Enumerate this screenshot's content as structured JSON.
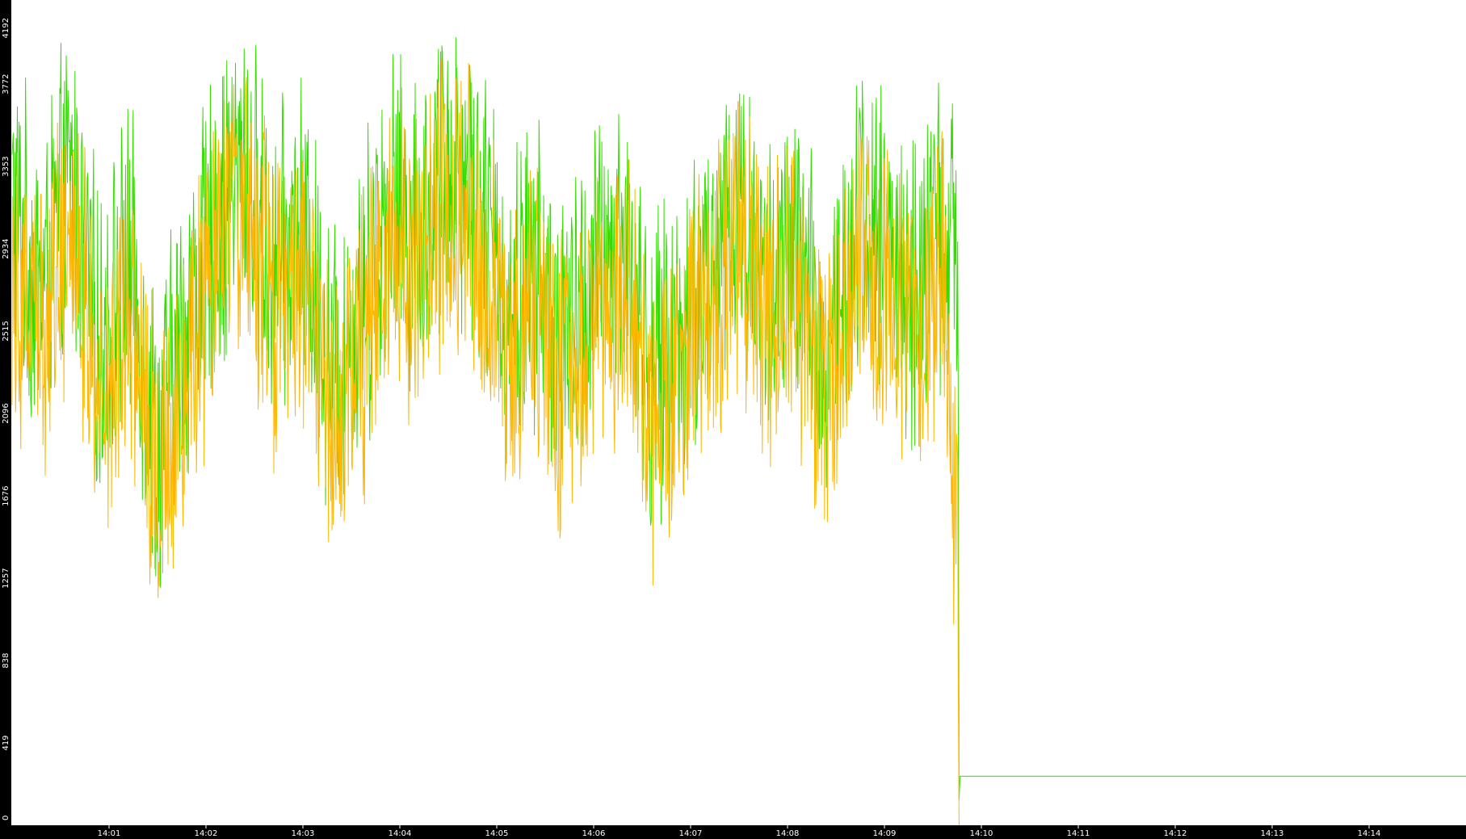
{
  "chart_data": {
    "type": "line",
    "title": "",
    "xlabel": "",
    "ylabel": "",
    "ylim": [
      0,
      4192
    ],
    "xlim_minutes": [
      14.0,
      15.0
    ],
    "y_ticks": [
      "0",
      "419",
      "838",
      "1257",
      "1676",
      "2096",
      "2515",
      "2934",
      "3353",
      "3772",
      "4192"
    ],
    "x_ticks": [
      {
        "label": "14:01",
        "t": 14.0167
      },
      {
        "label": "14:02",
        "t": 14.0333
      },
      {
        "label": "14:03",
        "t": 14.05
      },
      {
        "label": "14:04",
        "t": 14.0667
      },
      {
        "label": "14:05",
        "t": 14.0833
      },
      {
        "label": "14:06",
        "t": 14.1
      },
      {
        "label": "14:07",
        "t": 14.1167
      },
      {
        "label": "14:08",
        "t": 14.1333
      },
      {
        "label": "14:09",
        "t": 14.15
      },
      {
        "label": "14:10",
        "t": 14.1667
      },
      {
        "label": "14:11",
        "t": 14.1833
      },
      {
        "label": "14:12",
        "t": 14.2
      },
      {
        "label": "14:13",
        "t": 14.2167
      },
      {
        "label": "14:14",
        "t": 14.2333
      }
    ],
    "grid": false,
    "colors": {
      "axis_band": "#000000",
      "background": "#ffffff",
      "series_green": "#33dd00",
      "series_orange": "#ffb800"
    },
    "series": [
      {
        "color": "#33dd00",
        "x_minutes": [
          0.0,
          0.3,
          0.6,
          0.9,
          1.2,
          1.5,
          1.8,
          2.1,
          2.4,
          2.7,
          3.0,
          3.3,
          3.6,
          3.9,
          4.2,
          4.5,
          4.8,
          5.1,
          5.4,
          5.7,
          6.0,
          6.3,
          6.6,
          6.9,
          7.2,
          7.5,
          7.8,
          8.1,
          8.4,
          8.7,
          9.0,
          9.3,
          9.6,
          9.76,
          9.77,
          9.78,
          15.0
        ],
        "values": [
          3150,
          2700,
          3300,
          2400,
          2900,
          1900,
          2600,
          3050,
          3350,
          2800,
          3000,
          2300,
          2650,
          3200,
          3000,
          3400,
          3250,
          2600,
          2850,
          2400,
          2750,
          3000,
          2250,
          2500,
          2800,
          3200,
          2700,
          2900,
          2300,
          3150,
          2950,
          2700,
          3050,
          2800,
          130,
          250,
          250
        ]
      },
      {
        "color": "#ffb800",
        "x_minutes": [
          0.0,
          0.3,
          0.6,
          0.9,
          1.2,
          1.5,
          1.8,
          2.1,
          2.4,
          2.7,
          3.0,
          3.3,
          3.6,
          3.9,
          4.2,
          4.5,
          4.8,
          5.1,
          5.4,
          5.7,
          6.0,
          6.3,
          6.6,
          6.9,
          7.2,
          7.5,
          7.8,
          8.1,
          8.4,
          8.7,
          9.0,
          9.3,
          9.6,
          9.76,
          9.77
        ],
        "values": [
          2900,
          2500,
          3100,
          2100,
          2750,
          1700,
          2400,
          2850,
          3150,
          2600,
          2800,
          2100,
          2450,
          3000,
          2800,
          3200,
          3050,
          2400,
          2650,
          2200,
          2500,
          2800,
          2050,
          2300,
          2600,
          3000,
          2500,
          2700,
          2100,
          2950,
          2750,
          2500,
          2850,
          1300,
          0
        ]
      }
    ]
  }
}
